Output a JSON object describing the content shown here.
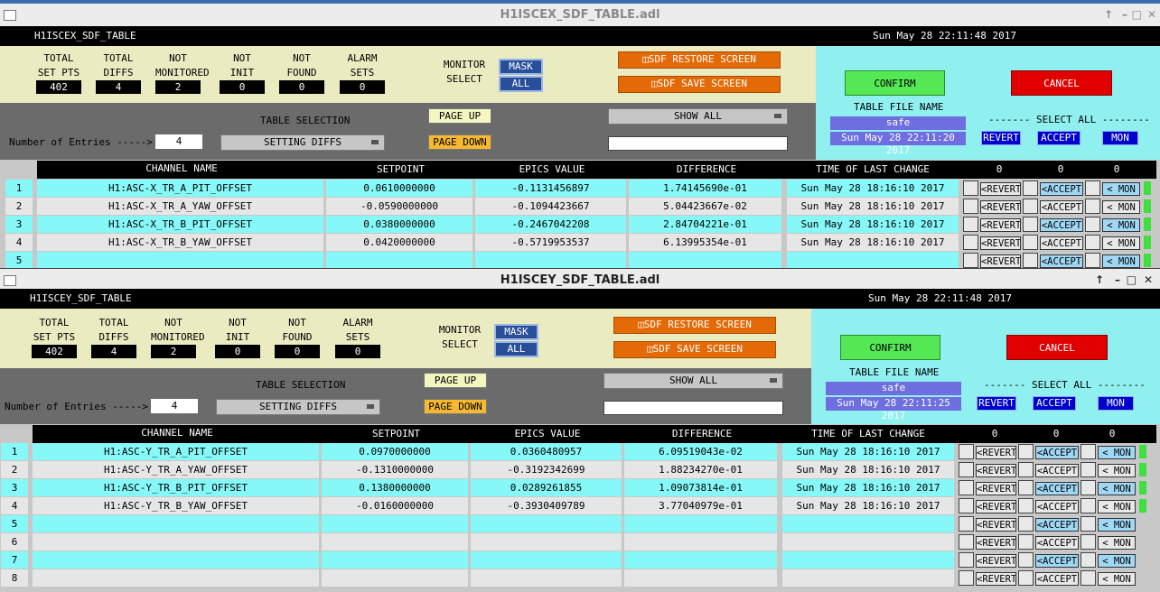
{
  "windows": [
    {
      "title": "H1ISCEX_SDF_TABLE.adl",
      "model": "H1ISCEX_SDF_TABLE",
      "datetime": "Sun May 28 22:11:48 2017",
      "stats": [
        {
          "label1": "TOTAL",
          "label2": "SET PTS",
          "value": "402"
        },
        {
          "label1": "TOTAL",
          "label2": "DIFFS",
          "value": "4"
        },
        {
          "label1": "NOT",
          "label2": "MONITORED",
          "value": "2"
        },
        {
          "label1": "NOT",
          "label2": "INIT",
          "value": "0"
        },
        {
          "label1": "NOT",
          "label2": "FOUND",
          "value": "0"
        },
        {
          "label1": "ALARM",
          "label2": "SETS",
          "value": "0"
        }
      ],
      "monitor_select_1": "MONITOR",
      "monitor_select_2": "SELECT",
      "mask_btn": "MASK",
      "all_btn": "ALL",
      "restore_btn": "SDF RESTORE SCREEN",
      "save_btn": "SDF SAVE SCREEN",
      "confirm_btn": "CONFIRM",
      "cancel_btn": "CANCEL",
      "table_file_name_label": "TABLE FILE NAME",
      "table_file_name": "safe",
      "table_file_time": "Sun May 28 22:11:20 2017",
      "select_all_label": "------- SELECT ALL --------",
      "revert_btn": "REVERT",
      "accept_btn": "ACCEPT",
      "mon_btn": "MON",
      "table_selection_label": "TABLE SELECTION",
      "table_selection_value": "SETTING DIFFS",
      "page_up": "PAGE UP",
      "page_down": "PAGE DOWN",
      "show_all": "SHOW ALL",
      "entries_label": "Number of Entries ----->",
      "entries_value": "4",
      "columns": {
        "channel": "CHANNEL NAME",
        "setpoint": "SETPOINT",
        "epics": "EPICS VALUE",
        "diff": "DIFFERENCE",
        "time": "TIME OF LAST CHANGE",
        "c1": "0",
        "c2": "0",
        "c3": "0"
      },
      "rows": [
        {
          "n": "1",
          "channel": "H1:ASC-X_TR_A_PIT_OFFSET",
          "setpoint": "0.0610000000",
          "epics": "-0.1131456897",
          "diff": "1.74145690e-01",
          "time": "Sun May 28 18:16:10 2017",
          "revert": "<REVERT",
          "accept": "<ACCEPT",
          "mon": "< MON"
        },
        {
          "n": "2",
          "channel": "H1:ASC-X_TR_A_YAW_OFFSET",
          "setpoint": "-0.0590000000",
          "epics": "-0.1094423667",
          "diff": "5.04423667e-02",
          "time": "Sun May 28 18:16:10 2017",
          "revert": "<REVERT",
          "accept": "<ACCEPT",
          "mon": "< MON"
        },
        {
          "n": "3",
          "channel": "H1:ASC-X_TR_B_PIT_OFFSET",
          "setpoint": "0.0380000000",
          "epics": "-0.2467042208",
          "diff": "2.84704221e-01",
          "time": "Sun May 28 18:16:10 2017",
          "revert": "<REVERT",
          "accept": "<ACCEPT",
          "mon": "< MON"
        },
        {
          "n": "4",
          "channel": "H1:ASC-X_TR_B_YAW_OFFSET",
          "setpoint": "0.0420000000",
          "epics": "-0.5719953537",
          "diff": "6.13995354e-01",
          "time": "Sun May 28 18:16:10 2017",
          "revert": "<REVERT",
          "accept": "<ACCEPT",
          "mon": "< MON"
        },
        {
          "n": "5",
          "channel": "",
          "setpoint": "",
          "epics": "",
          "diff": "",
          "time": "",
          "revert": "<REVERT",
          "accept": "<ACCEPT",
          "mon": "< MON"
        }
      ]
    },
    {
      "title": "H1ISCEY_SDF_TABLE.adl",
      "model": "H1ISCEY_SDF_TABLE",
      "datetime": "Sun May 28 22:11:48 2017",
      "stats": [
        {
          "label1": "TOTAL",
          "label2": "SET PTS",
          "value": "402"
        },
        {
          "label1": "TOTAL",
          "label2": "DIFFS",
          "value": "4"
        },
        {
          "label1": "NOT",
          "label2": "MONITORED",
          "value": "2"
        },
        {
          "label1": "NOT",
          "label2": "INIT",
          "value": "0"
        },
        {
          "label1": "NOT",
          "label2": "FOUND",
          "value": "0"
        },
        {
          "label1": "ALARM",
          "label2": "SETS",
          "value": "0"
        }
      ],
      "monitor_select_1": "MONITOR",
      "monitor_select_2": "SELECT",
      "mask_btn": "MASK",
      "all_btn": "ALL",
      "restore_btn": "SDF RESTORE SCREEN",
      "save_btn": "SDF SAVE SCREEN",
      "confirm_btn": "CONFIRM",
      "cancel_btn": "CANCEL",
      "table_file_name_label": "TABLE FILE NAME",
      "table_file_name": "safe",
      "table_file_time": "Sun May 28 22:11:25 2017",
      "select_all_label": "------- SELECT ALL --------",
      "revert_btn": "REVERT",
      "accept_btn": "ACCEPT",
      "mon_btn": "MON",
      "table_selection_label": "TABLE SELECTION",
      "table_selection_value": "SETTING DIFFS",
      "page_up": "PAGE UP",
      "page_down": "PAGE DOWN",
      "show_all": "SHOW ALL",
      "entries_label": "Number of Entries ----->",
      "entries_value": "4",
      "columns": {
        "channel": "CHANNEL NAME",
        "setpoint": "SETPOINT",
        "epics": "EPICS VALUE",
        "diff": "DIFFERENCE",
        "time": "TIME OF LAST CHANGE",
        "c1": "0",
        "c2": "0",
        "c3": "0"
      },
      "rows": [
        {
          "n": "1",
          "channel": "H1:ASC-Y_TR_A_PIT_OFFSET",
          "setpoint": "0.0970000000",
          "epics": "0.0360480957",
          "diff": "6.09519043e-02",
          "time": "Sun May 28 18:16:10 2017",
          "revert": "<REVERT",
          "accept": "<ACCEPT",
          "mon": "< MON"
        },
        {
          "n": "2",
          "channel": "H1:ASC-Y_TR_A_YAW_OFFSET",
          "setpoint": "-0.1310000000",
          "epics": "-0.3192342699",
          "diff": "1.88234270e-01",
          "time": "Sun May 28 18:16:10 2017",
          "revert": "<REVERT",
          "accept": "<ACCEPT",
          "mon": "< MON"
        },
        {
          "n": "3",
          "channel": "H1:ASC-Y_TR_B_PIT_OFFSET",
          "setpoint": "0.1380000000",
          "epics": "0.0289261855",
          "diff": "1.09073814e-01",
          "time": "Sun May 28 18:16:10 2017",
          "revert": "<REVERT",
          "accept": "<ACCEPT",
          "mon": "< MON"
        },
        {
          "n": "4",
          "channel": "H1:ASC-Y_TR_B_YAW_OFFSET",
          "setpoint": "-0.0160000000",
          "epics": "-0.3930409789",
          "diff": "3.77040979e-01",
          "time": "Sun May 28 18:16:10 2017",
          "revert": "<REVERT",
          "accept": "<ACCEPT",
          "mon": "< MON"
        },
        {
          "n": "5",
          "channel": "",
          "setpoint": "",
          "epics": "",
          "diff": "",
          "time": "",
          "revert": "<REVERT",
          "accept": "<ACCEPT",
          "mon": "< MON"
        },
        {
          "n": "6",
          "channel": "",
          "setpoint": "",
          "epics": "",
          "diff": "",
          "time": "",
          "revert": "<REVERT",
          "accept": "<ACCEPT",
          "mon": "< MON"
        },
        {
          "n": "7",
          "channel": "",
          "setpoint": "",
          "epics": "",
          "diff": "",
          "time": "",
          "revert": "<REVERT",
          "accept": "<ACCEPT",
          "mon": "< MON"
        },
        {
          "n": "8",
          "channel": "",
          "setpoint": "",
          "epics": "",
          "diff": "",
          "time": "",
          "revert": "<REVERT",
          "accept": "<ACCEPT",
          "mon": "< MON"
        }
      ]
    }
  ],
  "colors": {
    "panel_yellow": "#ebebc2",
    "panel_cyan": "#90f0f0",
    "row_cyan": "#86f8f8",
    "row_gray": "#e6e6e6",
    "orange": "#e36a07",
    "confirm_green": "#54e854",
    "cancel_red": "#e00000"
  },
  "icons": {
    "maximize": "window-maximize-icon",
    "minimize": "window-minimize-icon",
    "restore": "window-restore-icon",
    "close": "window-close-icon",
    "screen": "screen-icon"
  }
}
